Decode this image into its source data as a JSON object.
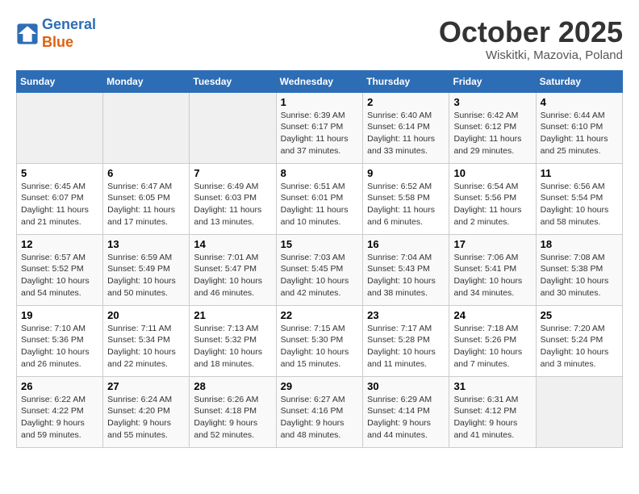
{
  "header": {
    "logo_line1": "General",
    "logo_line2": "Blue",
    "month": "October 2025",
    "location": "Wiskitki, Mazovia, Poland"
  },
  "weekdays": [
    "Sunday",
    "Monday",
    "Tuesday",
    "Wednesday",
    "Thursday",
    "Friday",
    "Saturday"
  ],
  "weeks": [
    [
      {
        "day": "",
        "info": ""
      },
      {
        "day": "",
        "info": ""
      },
      {
        "day": "",
        "info": ""
      },
      {
        "day": "1",
        "info": "Sunrise: 6:39 AM\nSunset: 6:17 PM\nDaylight: 11 hours and 37 minutes."
      },
      {
        "day": "2",
        "info": "Sunrise: 6:40 AM\nSunset: 6:14 PM\nDaylight: 11 hours and 33 minutes."
      },
      {
        "day": "3",
        "info": "Sunrise: 6:42 AM\nSunset: 6:12 PM\nDaylight: 11 hours and 29 minutes."
      },
      {
        "day": "4",
        "info": "Sunrise: 6:44 AM\nSunset: 6:10 PM\nDaylight: 11 hours and 25 minutes."
      }
    ],
    [
      {
        "day": "5",
        "info": "Sunrise: 6:45 AM\nSunset: 6:07 PM\nDaylight: 11 hours and 21 minutes."
      },
      {
        "day": "6",
        "info": "Sunrise: 6:47 AM\nSunset: 6:05 PM\nDaylight: 11 hours and 17 minutes."
      },
      {
        "day": "7",
        "info": "Sunrise: 6:49 AM\nSunset: 6:03 PM\nDaylight: 11 hours and 13 minutes."
      },
      {
        "day": "8",
        "info": "Sunrise: 6:51 AM\nSunset: 6:01 PM\nDaylight: 11 hours and 10 minutes."
      },
      {
        "day": "9",
        "info": "Sunrise: 6:52 AM\nSunset: 5:58 PM\nDaylight: 11 hours and 6 minutes."
      },
      {
        "day": "10",
        "info": "Sunrise: 6:54 AM\nSunset: 5:56 PM\nDaylight: 11 hours and 2 minutes."
      },
      {
        "day": "11",
        "info": "Sunrise: 6:56 AM\nSunset: 5:54 PM\nDaylight: 10 hours and 58 minutes."
      }
    ],
    [
      {
        "day": "12",
        "info": "Sunrise: 6:57 AM\nSunset: 5:52 PM\nDaylight: 10 hours and 54 minutes."
      },
      {
        "day": "13",
        "info": "Sunrise: 6:59 AM\nSunset: 5:49 PM\nDaylight: 10 hours and 50 minutes."
      },
      {
        "day": "14",
        "info": "Sunrise: 7:01 AM\nSunset: 5:47 PM\nDaylight: 10 hours and 46 minutes."
      },
      {
        "day": "15",
        "info": "Sunrise: 7:03 AM\nSunset: 5:45 PM\nDaylight: 10 hours and 42 minutes."
      },
      {
        "day": "16",
        "info": "Sunrise: 7:04 AM\nSunset: 5:43 PM\nDaylight: 10 hours and 38 minutes."
      },
      {
        "day": "17",
        "info": "Sunrise: 7:06 AM\nSunset: 5:41 PM\nDaylight: 10 hours and 34 minutes."
      },
      {
        "day": "18",
        "info": "Sunrise: 7:08 AM\nSunset: 5:38 PM\nDaylight: 10 hours and 30 minutes."
      }
    ],
    [
      {
        "day": "19",
        "info": "Sunrise: 7:10 AM\nSunset: 5:36 PM\nDaylight: 10 hours and 26 minutes."
      },
      {
        "day": "20",
        "info": "Sunrise: 7:11 AM\nSunset: 5:34 PM\nDaylight: 10 hours and 22 minutes."
      },
      {
        "day": "21",
        "info": "Sunrise: 7:13 AM\nSunset: 5:32 PM\nDaylight: 10 hours and 18 minutes."
      },
      {
        "day": "22",
        "info": "Sunrise: 7:15 AM\nSunset: 5:30 PM\nDaylight: 10 hours and 15 minutes."
      },
      {
        "day": "23",
        "info": "Sunrise: 7:17 AM\nSunset: 5:28 PM\nDaylight: 10 hours and 11 minutes."
      },
      {
        "day": "24",
        "info": "Sunrise: 7:18 AM\nSunset: 5:26 PM\nDaylight: 10 hours and 7 minutes."
      },
      {
        "day": "25",
        "info": "Sunrise: 7:20 AM\nSunset: 5:24 PM\nDaylight: 10 hours and 3 minutes."
      }
    ],
    [
      {
        "day": "26",
        "info": "Sunrise: 6:22 AM\nSunset: 4:22 PM\nDaylight: 9 hours and 59 minutes."
      },
      {
        "day": "27",
        "info": "Sunrise: 6:24 AM\nSunset: 4:20 PM\nDaylight: 9 hours and 55 minutes."
      },
      {
        "day": "28",
        "info": "Sunrise: 6:26 AM\nSunset: 4:18 PM\nDaylight: 9 hours and 52 minutes."
      },
      {
        "day": "29",
        "info": "Sunrise: 6:27 AM\nSunset: 4:16 PM\nDaylight: 9 hours and 48 minutes."
      },
      {
        "day": "30",
        "info": "Sunrise: 6:29 AM\nSunset: 4:14 PM\nDaylight: 9 hours and 44 minutes."
      },
      {
        "day": "31",
        "info": "Sunrise: 6:31 AM\nSunset: 4:12 PM\nDaylight: 9 hours and 41 minutes."
      },
      {
        "day": "",
        "info": ""
      }
    ]
  ]
}
